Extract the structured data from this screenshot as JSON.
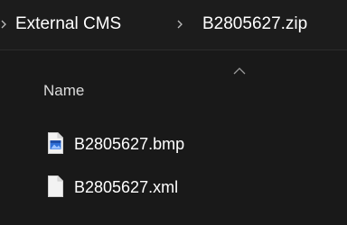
{
  "breadcrumb": {
    "items": [
      {
        "label": "External CMS"
      },
      {
        "label": "B2805627.zip"
      }
    ]
  },
  "columns": {
    "name_header": "Name",
    "sort_direction": "ascending"
  },
  "files": [
    {
      "name": "B2805627.bmp",
      "icon": "bitmap-file-icon"
    },
    {
      "name": "B2805627.xml",
      "icon": "document-file-icon"
    }
  ],
  "colors": {
    "background": "#191919",
    "text": "#ffffff",
    "muted_text": "#dcdcdc",
    "bitmap_icon_accent": "#2f6fd6"
  }
}
